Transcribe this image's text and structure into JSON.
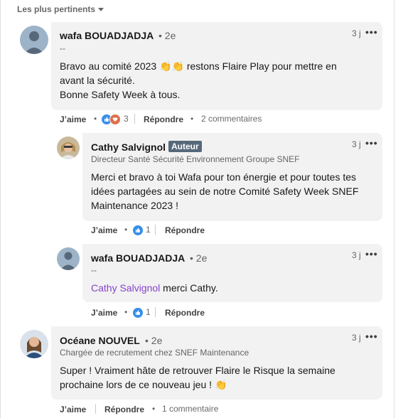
{
  "sort": {
    "label": "Les plus pertinents"
  },
  "colors": {
    "mention": "#8344cc",
    "badge": "#56687a",
    "like": "#378fe9",
    "love": "#df704d"
  },
  "comments": [
    {
      "author": "wafa BOUADJADJA",
      "degree": "• 2e",
      "headline": "--",
      "time": "3 j",
      "line1": "Bravo au comité 2023",
      "line1b": "restons Flaire Play pour mettre en",
      "line2": "avant la sécurité.",
      "line3": "Bonne Safety Week à tous.",
      "like_label": "J’aime",
      "reactions": "3",
      "reply_label": "Répondre",
      "replies_count": "2 commentaires"
    },
    {
      "author": "Cathy Salvignol",
      "badge": "Auteur",
      "headline": "Directeur Santé Sécurité Environnement Groupe SNEF",
      "time": "3 j",
      "line1": "Merci et bravo à toi Wafa pour ton énergie et pour toutes tes",
      "line2": "idées partagées au sein de notre Comité Safety Week SNEF",
      "line3": "Maintenance 2023 !",
      "like_label": "J’aime",
      "reactions": "1",
      "reply_label": "Répondre"
    },
    {
      "author": "wafa BOUADJADJA",
      "degree": "• 2e",
      "headline": "--",
      "time": "3 j",
      "mention": "Cathy Salvignol",
      "line1": " merci Cathy.",
      "like_label": "J’aime",
      "reactions": "1",
      "reply_label": "Répondre"
    },
    {
      "author": "Océane NOUVEL",
      "degree": "• 2e",
      "headline": "Chargée de recrutement chez SNEF Maintenance",
      "time": "3 j",
      "line1": "Super ! Vraiment hâte de retrouver Flaire le Risque la semaine",
      "line2": "prochaine lors de ce nouveau jeu !",
      "like_label": "J’aime",
      "reply_label": "Répondre",
      "replies_count": "1 commentaire"
    }
  ],
  "icons": {
    "more": "more-horizontal-icon",
    "like": "thumbs-up-icon",
    "love": "heart-icon",
    "clap": "clapping-hands-emoji",
    "sort_caret": "caret-down-icon"
  }
}
